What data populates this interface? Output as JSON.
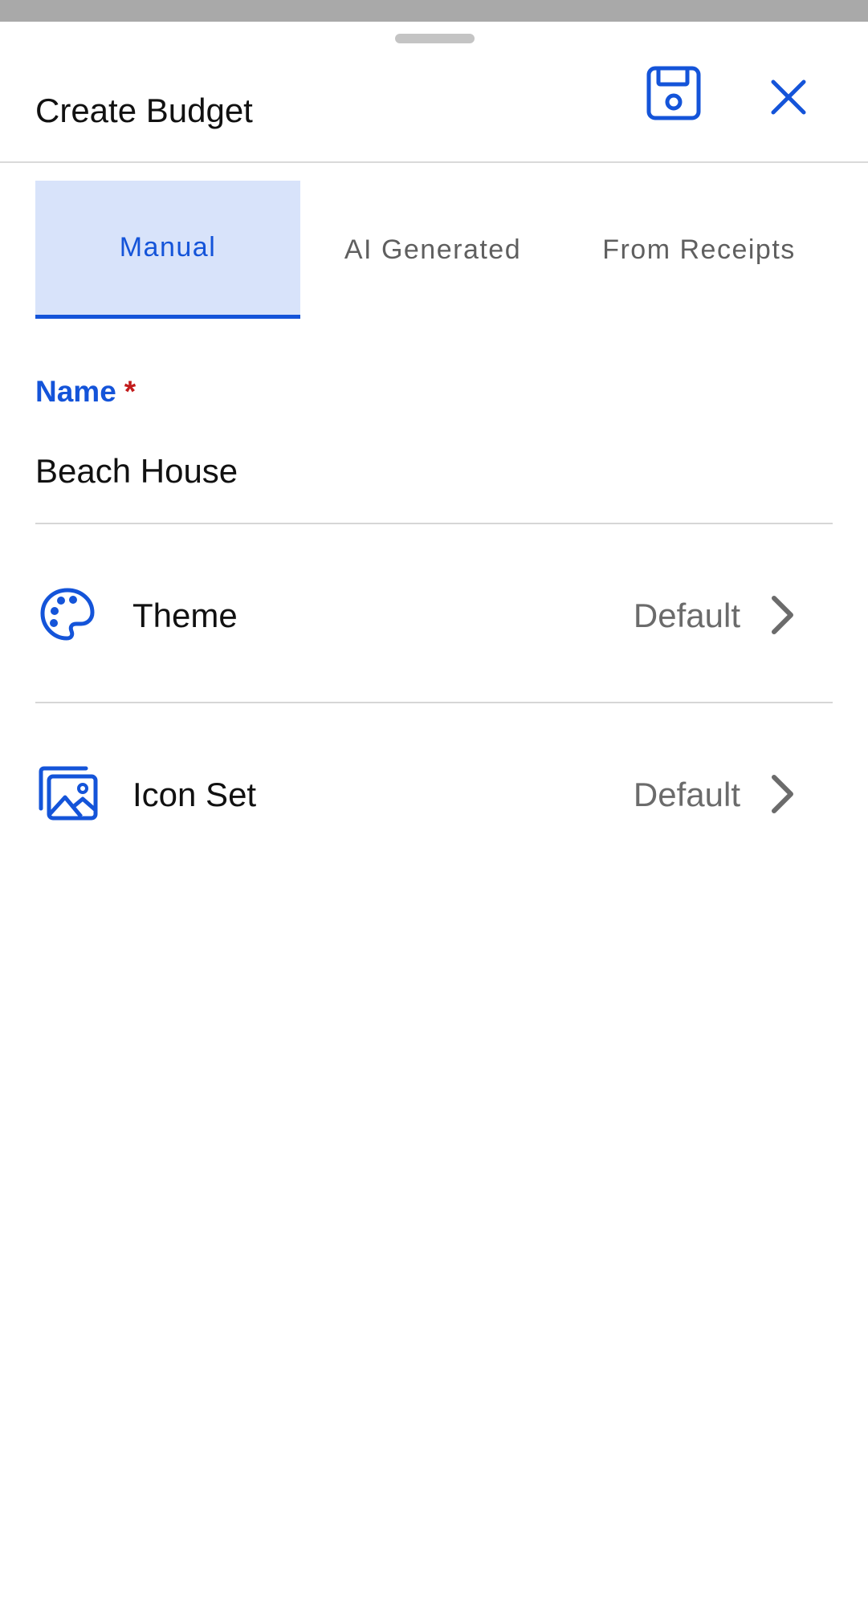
{
  "header": {
    "title": "Create Budget",
    "save_icon": "floppy-disk-icon",
    "close_icon": "close-x-icon"
  },
  "tabs": [
    {
      "label": "Manual",
      "selected": true
    },
    {
      "label": "AI Generated",
      "selected": false
    },
    {
      "label": "From Receipts",
      "selected": false
    }
  ],
  "form": {
    "name_label": "Name",
    "required_marker": "*",
    "name_value": "Beach House"
  },
  "settings": [
    {
      "label": "Theme",
      "value": "Default",
      "icon": "palette-icon"
    },
    {
      "label": "Icon Set",
      "value": "Default",
      "icon": "images-icon"
    }
  ],
  "colors": {
    "accent": "#1454d9",
    "tab_selected_bg": "#d8e3fa",
    "required": "#c21b1b",
    "secondary_text": "#6b6b6b"
  }
}
